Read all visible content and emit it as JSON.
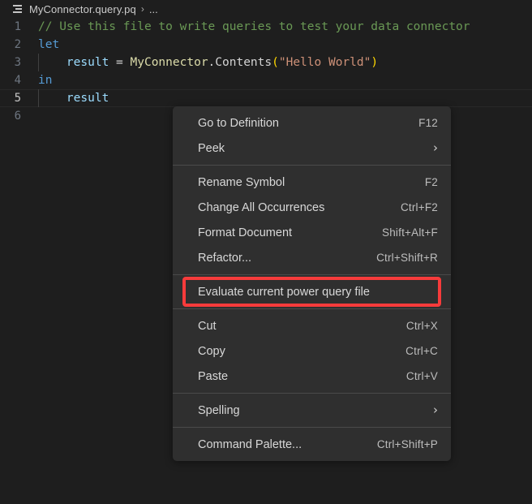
{
  "breadcrumb": {
    "icon": "outline-list-icon",
    "file": "MyConnector.query.pq",
    "separator": "›",
    "ellipsis": "..."
  },
  "editor": {
    "lines": [
      {
        "num": "1",
        "active": false,
        "indent_guide": false,
        "tokens": [
          {
            "text": "// Use this file to write queries to test your data connector",
            "type": "comment"
          }
        ]
      },
      {
        "num": "2",
        "active": false,
        "indent_guide": false,
        "tokens": [
          {
            "text": "let",
            "type": "keyword"
          }
        ]
      },
      {
        "num": "3",
        "active": false,
        "indent_guide": true,
        "tokens": [
          {
            "text": "    ",
            "type": "plain"
          },
          {
            "text": "result",
            "type": "var"
          },
          {
            "text": " = ",
            "type": "op"
          },
          {
            "text": "MyConnector",
            "type": "type"
          },
          {
            "text": ".Contents",
            "type": "plain"
          },
          {
            "text": "(",
            "type": "paren"
          },
          {
            "text": "\"Hello World\"",
            "type": "string"
          },
          {
            "text": ")",
            "type": "paren"
          }
        ]
      },
      {
        "num": "4",
        "active": false,
        "indent_guide": false,
        "tokens": [
          {
            "text": "in",
            "type": "keyword"
          }
        ]
      },
      {
        "num": "5",
        "active": true,
        "indent_guide": true,
        "tokens": [
          {
            "text": "    ",
            "type": "plain"
          },
          {
            "text": "result",
            "type": "var"
          }
        ]
      },
      {
        "num": "6",
        "active": false,
        "indent_guide": false,
        "tokens": []
      }
    ]
  },
  "context_menu": {
    "items": [
      {
        "kind": "item",
        "name": "go-to-definition",
        "label": "Go to Definition",
        "shortcut": "F12",
        "submenu": false,
        "highlighted": false
      },
      {
        "kind": "item",
        "name": "peek",
        "label": "Peek",
        "shortcut": "",
        "submenu": true,
        "highlighted": false
      },
      {
        "kind": "separator"
      },
      {
        "kind": "item",
        "name": "rename-symbol",
        "label": "Rename Symbol",
        "shortcut": "F2",
        "submenu": false,
        "highlighted": false
      },
      {
        "kind": "item",
        "name": "change-all-occurrences",
        "label": "Change All Occurrences",
        "shortcut": "Ctrl+F2",
        "submenu": false,
        "highlighted": false
      },
      {
        "kind": "item",
        "name": "format-document",
        "label": "Format Document",
        "shortcut": "Shift+Alt+F",
        "submenu": false,
        "highlighted": false
      },
      {
        "kind": "item",
        "name": "refactor",
        "label": "Refactor...",
        "shortcut": "Ctrl+Shift+R",
        "submenu": false,
        "highlighted": false
      },
      {
        "kind": "separator"
      },
      {
        "kind": "item",
        "name": "evaluate-current-power-query-file",
        "label": "Evaluate current power query file",
        "shortcut": "",
        "submenu": false,
        "highlighted": true
      },
      {
        "kind": "separator"
      },
      {
        "kind": "item",
        "name": "cut",
        "label": "Cut",
        "shortcut": "Ctrl+X",
        "submenu": false,
        "highlighted": false
      },
      {
        "kind": "item",
        "name": "copy",
        "label": "Copy",
        "shortcut": "Ctrl+C",
        "submenu": false,
        "highlighted": false
      },
      {
        "kind": "item",
        "name": "paste",
        "label": "Paste",
        "shortcut": "Ctrl+V",
        "submenu": false,
        "highlighted": false
      },
      {
        "kind": "separator"
      },
      {
        "kind": "item",
        "name": "spelling",
        "label": "Spelling",
        "shortcut": "",
        "submenu": true,
        "highlighted": false
      },
      {
        "kind": "separator"
      },
      {
        "kind": "item",
        "name": "command-palette",
        "label": "Command Palette...",
        "shortcut": "Ctrl+Shift+P",
        "submenu": false,
        "highlighted": false
      }
    ],
    "submenu_glyph": "›",
    "highlight_color": "#f73b3b"
  }
}
